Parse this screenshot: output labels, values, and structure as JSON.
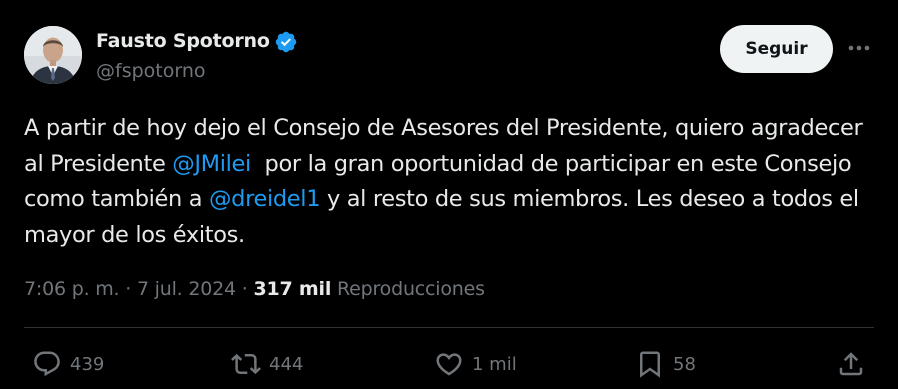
{
  "author": {
    "name": "Fausto Spotorno",
    "handle": "@fspotorno",
    "verified": true
  },
  "follow_label": "Seguir",
  "tweet": {
    "part1": "A partir de hoy dejo el Consejo de Asesores del Presidente, quiero agradecer al Presidente ",
    "mention1": "@JMilei",
    "part2": "  por la gran oportunidad de participar en este Consejo como también a ",
    "mention2": "@dreidel1",
    "part3": " y al resto de sus miembros. Les deseo a todos el mayor de los éxitos."
  },
  "meta": {
    "time": "7:06 p. m.",
    "sep1": " · ",
    "date": "7 jul. 2024",
    "sep2": " · ",
    "views": "317 mil",
    "views_label": " Reproducciones"
  },
  "actions": {
    "replies": "439",
    "reposts": "444",
    "likes": "1 mil",
    "bookmarks": "58"
  },
  "colors": {
    "background": "#000000",
    "text": "#e7e9ea",
    "muted": "#71767b",
    "accent": "#1d9bf0"
  }
}
